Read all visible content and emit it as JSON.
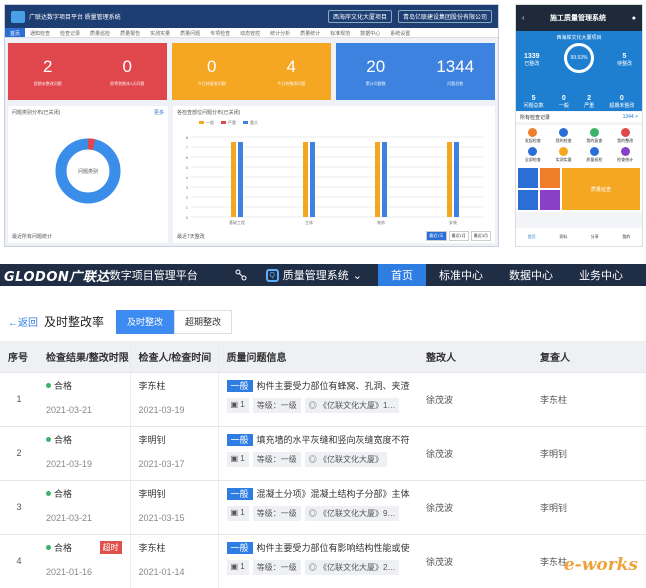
{
  "dashboard": {
    "logo_text": "广联达数字项目平台 质量管理系统",
    "project": "西海岸文化大厦项目",
    "company": "青岛亿联建设集团股份有限公司",
    "nav": [
      "首页",
      "通知检查",
      "检查记录",
      "质量巡检",
      "质量报告",
      "实测实量",
      "质量问题",
      "专项检查",
      "动态管控",
      "统计分析",
      "质量统计",
      "标准规范",
      "数据中心",
      "系统设置"
    ],
    "groups": [
      {
        "color": "#e0474c",
        "items": [
          {
            "value": "2",
            "label": "超期未整改问题"
          },
          {
            "value": "0",
            "label": "即将到期未3天问题"
          }
        ]
      },
      {
        "color": "#f5a623",
        "items": [
          {
            "value": "0",
            "label": "今日待复查问题"
          },
          {
            "value": "4",
            "label": "今日待整改问题"
          }
        ]
      },
      {
        "color": "#3e82e0",
        "items": [
          {
            "value": "20",
            "label": "累计问题数"
          },
          {
            "value": "1344",
            "label": "问题总数"
          }
        ]
      }
    ],
    "left_title": "问题类别分布(已关闭)",
    "left_link": "更多",
    "donut_center": "问题类别",
    "left_footer": "最近所有问题统计",
    "right_title": "各检查部位问题分布(已关闭)",
    "legend": [
      "一般",
      "严重",
      "重大"
    ],
    "bar_categories": [
      "基础工程",
      "主体",
      "装饰",
      "安装"
    ],
    "y_ticks": [
      "0",
      "1",
      "2",
      "3",
      "4",
      "5",
      "6",
      "7",
      "8"
    ],
    "right_footer": "最近7天整改",
    "footer_buttons": [
      "最近7天",
      "最近1月",
      "最近3月"
    ]
  },
  "phone": {
    "title": "施工质量管理系统",
    "project": "西海岸文化大厦项目",
    "rate": "99.53%",
    "left_stat": {
      "value": "1339",
      "label": "已整改"
    },
    "right_stat": {
      "value": "5",
      "label": "待整改"
    },
    "row": [
      {
        "v": "5",
        "l": "问题总数"
      },
      {
        "v": "0",
        "l": "一般"
      },
      {
        "v": "2",
        "l": "严重"
      },
      {
        "v": "0",
        "l": "超期未整改"
      }
    ],
    "bar_left": "所有检查记录",
    "bar_right": "1344 >",
    "icons": [
      "发起检查",
      "我的检查",
      "我的复查",
      "我的整改",
      "全部检查",
      "实测实量",
      "质量巡检",
      "检查统计"
    ],
    "big_tile": "质量巡查",
    "tabs": [
      "首页",
      "资料",
      "分享",
      "我的"
    ],
    "accent": "#1e7fd1"
  },
  "app": {
    "brand": "GLODON广联达",
    "platform": "数字项目管理平台",
    "system": "质量管理系统",
    "menu": [
      "首页",
      "标准中心",
      "数据中心",
      "业务中心"
    ],
    "back": "←返回",
    "page_title": "及时整改率",
    "tab_on": "及时整改",
    "tab_off": "超期整改",
    "columns": [
      "序号",
      "检查结果/整改时限",
      "检查人/检查时间",
      "质量问题信息",
      "整改人",
      "复查人"
    ],
    "rows": [
      {
        "no": "1",
        "result": "合格",
        "deadline": "2021-03-21",
        "overdue": "",
        "inspector": "李东柱",
        "inspect_date": "2021-03-19",
        "level_tag": "一般",
        "issue": "构件主要受力部位有蜂窝、孔洞、夹渣、混…",
        "photos": "1",
        "grade": "等级：一级",
        "project": "亿联文化大厦》1…",
        "rectifier": "徐茂波",
        "reviewer": "李东柱"
      },
      {
        "no": "2",
        "result": "合格",
        "deadline": "2021-03-19",
        "overdue": "",
        "inspector": "李明钊",
        "inspect_date": "2021-03-17",
        "level_tag": "一般",
        "issue": "填充墙的水平灰缝和竖向灰缝宽度不符合规…",
        "photos": "1",
        "grade": "等级：一级",
        "project": "亿联文化大厦》",
        "rectifier": "徐茂波",
        "reviewer": "李明钊"
      },
      {
        "no": "3",
        "result": "合格",
        "deadline": "2021-03-21",
        "overdue": "",
        "inspector": "李明钊",
        "inspect_date": "2021-03-15",
        "level_tag": "一般",
        "issue": "混凝土分项》混凝土结构子分部》主体结构…",
        "photos": "1",
        "grade": "等级：一级",
        "project": "亿联文化大厦》9…",
        "rectifier": "徐茂波",
        "reviewer": "李明钊"
      },
      {
        "no": "4",
        "result": "合格",
        "deadline": "2021-01-16",
        "overdue": "超时",
        "inspector": "李东柱",
        "inspect_date": "2021-01-14",
        "level_tag": "一般",
        "issue": "构件主要受力部位有影响结构性能或使用性…",
        "photos": "1",
        "grade": "等级：一级",
        "project": "亿联文化大厦》2…",
        "rectifier": "徐茂波",
        "reviewer": "李东柱"
      }
    ]
  },
  "watermark": "e-works"
}
